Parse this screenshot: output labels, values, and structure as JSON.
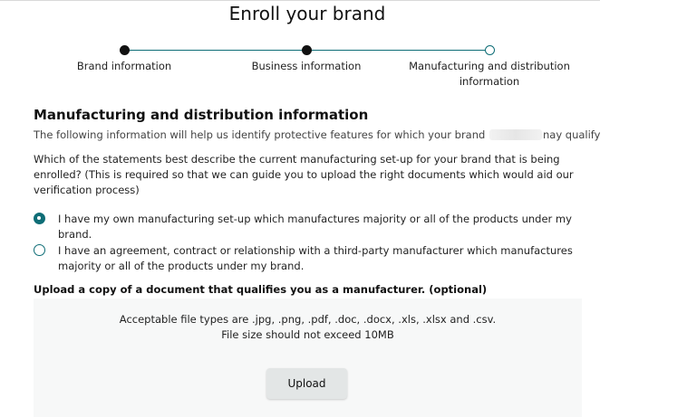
{
  "header": {
    "title": "Enroll your brand"
  },
  "stepper": {
    "steps": [
      {
        "label": "Brand information",
        "state": "done"
      },
      {
        "label": "Business information",
        "state": "done"
      },
      {
        "label": "Manufacturing and distribution information",
        "state": "current"
      }
    ],
    "accent_color": "#0e6d76"
  },
  "section": {
    "heading": "Manufacturing and distribution information",
    "intro_before": "The following information will help us identify protective features for which your brand",
    "intro_after": "nay qualify",
    "question": "Which of the statements best describe the current manufacturing set-up for your brand that is being enrolled? (This is required so that we can guide you to upload the right documents which would aid our verification process)"
  },
  "options": [
    {
      "label": "I have my own manufacturing set-up which manufactures majority or all of the products under my brand.",
      "selected": true
    },
    {
      "label": "I have an agreement, contract or relationship with a third-party manufacturer which manufactures majority or all of the products under my brand.",
      "selected": false
    }
  ],
  "upload": {
    "heading": "Upload a copy of a document that qualifies you as a manufacturer. (optional)",
    "file_types": "Acceptable file types are .jpg, .png, .pdf, .doc, .docx, .xls, .xlsx and .csv.",
    "size_limit": "File size should not exceed 10MB",
    "button_label": "Upload"
  }
}
